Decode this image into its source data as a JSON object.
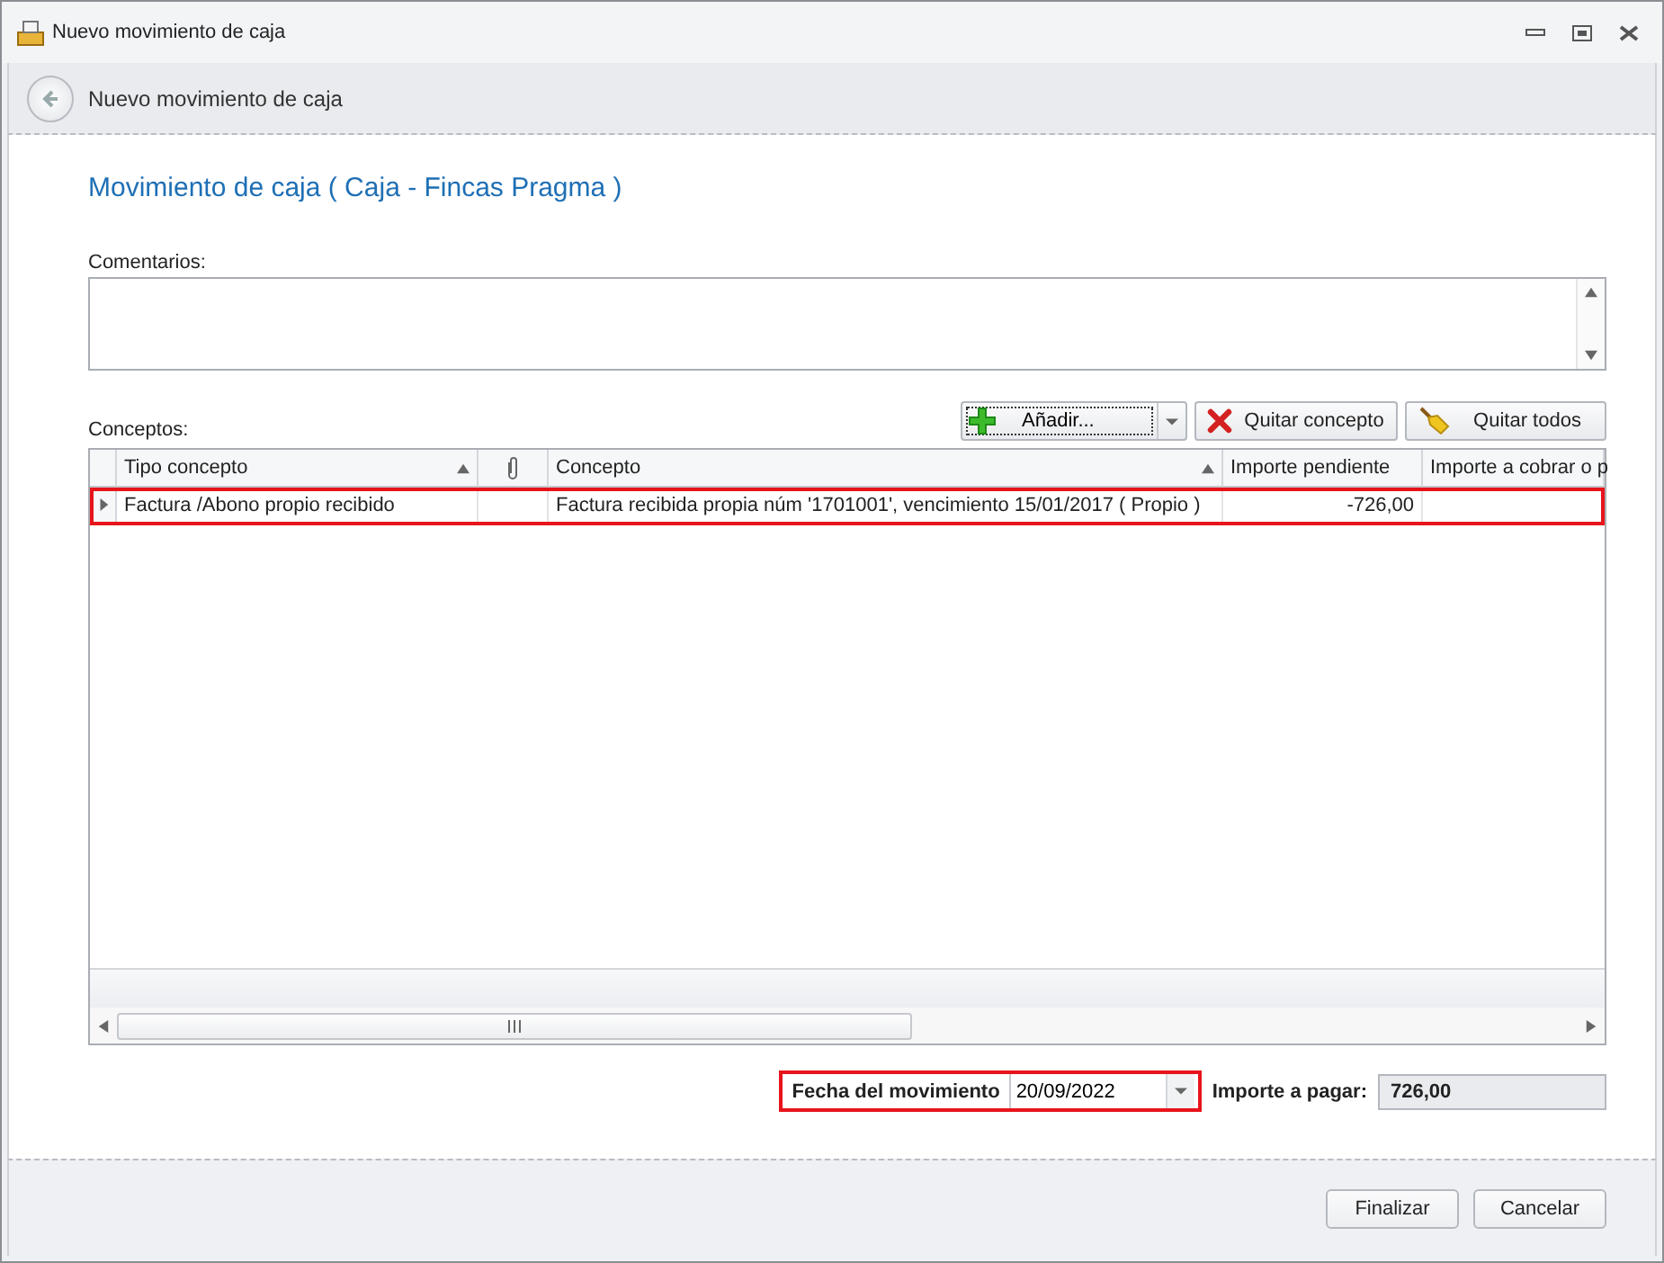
{
  "window": {
    "title": "Nuevo movimiento de caja"
  },
  "header": {
    "title": "Nuevo movimiento de caja"
  },
  "heading": "Movimiento de caja ( Caja - Fincas Pragma )",
  "comments": {
    "label": "Comentarios:"
  },
  "concepts": {
    "label": "Conceptos:",
    "toolbar": [
      {
        "kind": "add",
        "label": "Añadir..."
      },
      {
        "kind": "remove",
        "label": "Quitar concepto"
      },
      {
        "kind": "clear",
        "label": "Quitar todos"
      }
    ],
    "columns": [
      {
        "kind": "text",
        "label": "Tipo concepto",
        "sorted": true
      },
      {
        "kind": "attachment",
        "sorted": false
      },
      {
        "kind": "text",
        "label": "Concepto",
        "sorted": true
      },
      {
        "kind": "text",
        "label": "Importe pendiente"
      },
      {
        "kind": "text",
        "label": "Importe a cobrar o p"
      }
    ],
    "rows": [
      {
        "highlighted": true,
        "current": true,
        "cells": [
          "Factura /Abono propio recibido",
          "",
          "Factura recibida propia núm '1701001', vencimiento 15/01/2017 ( Propio )",
          "-726,00",
          ""
        ]
      }
    ]
  },
  "date": {
    "label": "Fecha del movimiento",
    "value": "20/09/2022",
    "highlighted": true
  },
  "amount": {
    "label": "Importe a pagar:",
    "value": "726,00"
  },
  "buttons": [
    "Finalizar",
    "Cancelar"
  ]
}
